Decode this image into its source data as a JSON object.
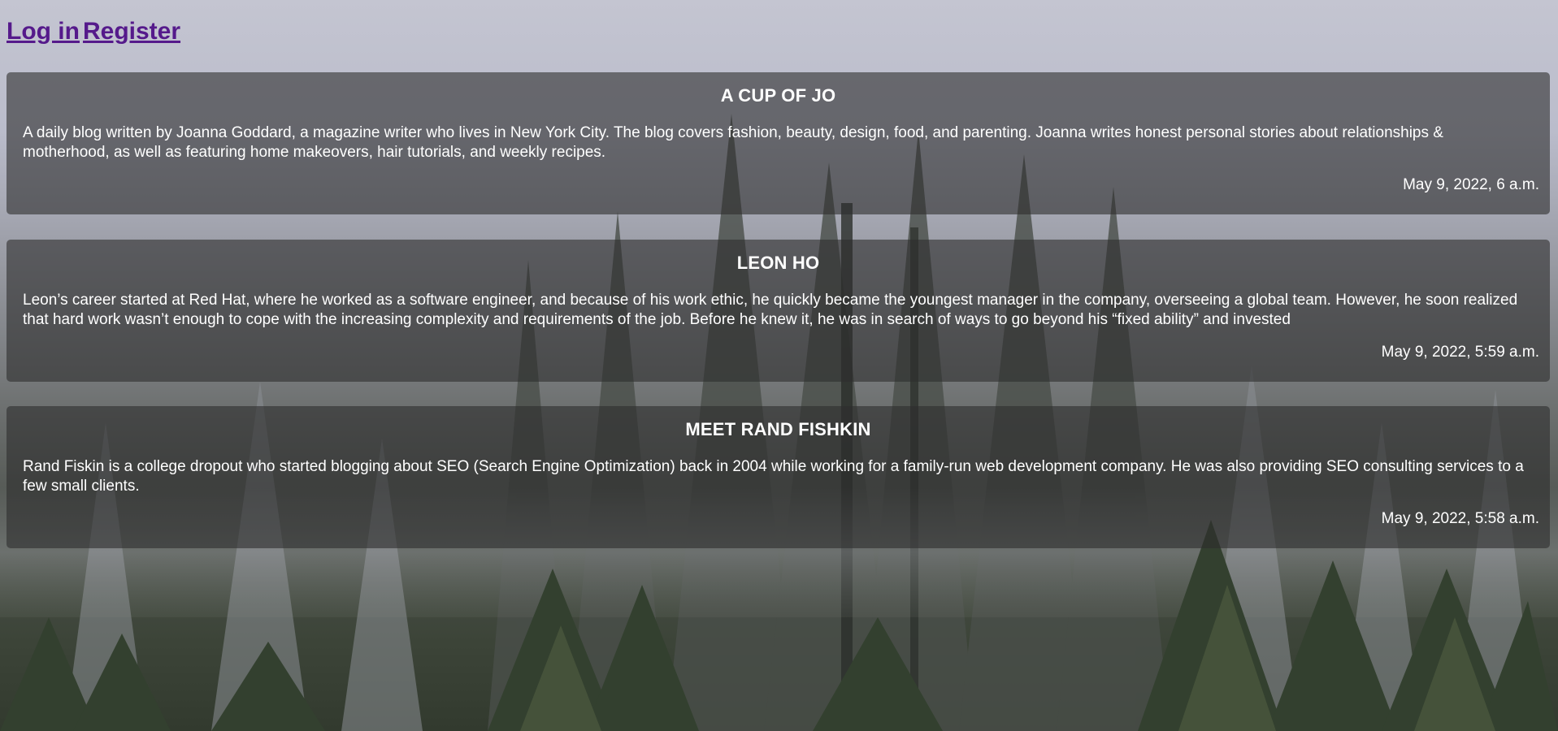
{
  "nav": {
    "login_label": "Log in",
    "register_label": "Register"
  },
  "posts": [
    {
      "title": "A CUP OF JO",
      "body": "A daily blog written by Joanna Goddard, a magazine writer who lives in New York City. The blog covers fashion, beauty, design, food, and parenting. Joanna writes honest personal stories about relationships & motherhood, as well as featuring home makeovers, hair tutorials, and weekly recipes.",
      "date": "May 9, 2022, 6 a.m."
    },
    {
      "title": "LEON HO",
      "body": "Leon’s career started at Red Hat, where he worked as a software engineer, and because of his work ethic, he quickly became the youngest manager in the company, overseeing a global team. However, he soon realized that hard work wasn’t enough to cope with the increasing complexity and requirements of the job. Before he knew it, he was in search of ways to go beyond his “fixed ability” and invested",
      "date": "May 9, 2022, 5:59 a.m."
    },
    {
      "title": "MEET RAND FISHKIN",
      "body": "Rand Fiskin is a college dropout who started blogging about SEO (Search Engine Optimization) back in 2004 while working for a family-run web development company. He was also providing SEO consulting services to a few small clients.",
      "date": "May 9, 2022, 5:58 a.m."
    }
  ],
  "colors": {
    "link": "#551a8b",
    "card_bg": "rgba(45,45,45,0.6)",
    "text": "#ffffff"
  }
}
